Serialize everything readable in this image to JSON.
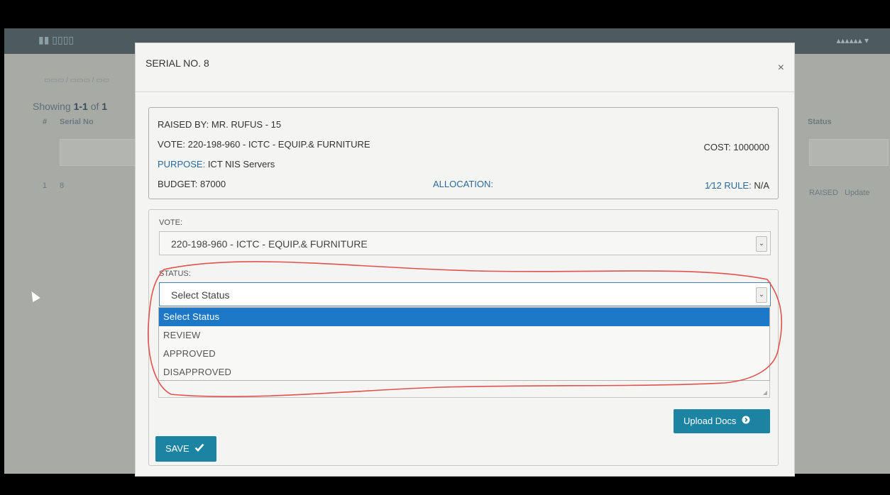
{
  "background": {
    "showing_prefix": "Showing",
    "showing_range": "1-1",
    "showing_of": "of",
    "showing_total": "1",
    "col_index": "#",
    "col_serial": "Serial No",
    "col_status": "Status",
    "row_index": "1",
    "row_serial": "8",
    "row_status": "RAISED",
    "row_action": "Update"
  },
  "modal": {
    "title": "SERIAL NO. 8",
    "close_symbol": "×",
    "info": {
      "raised_by_label": "RAISED BY:",
      "raised_by_value": "MR. RUFUS - 15",
      "vote_label": "VOTE:",
      "vote_value": "220-198-960 - ICTC - EQUIP.& FURNITURE",
      "cost_label": "COST:",
      "cost_value": "1000000",
      "purpose_label": "PURPOSE:",
      "purpose_value": "ICT NIS Servers",
      "budget_label": "BUDGET:",
      "budget_value": "87000",
      "allocation_label": "ALLOCATION:",
      "allocation_value": "",
      "rule_label": "1⁄12 RULE:",
      "rule_value": "N/A"
    },
    "form": {
      "vote_label": "VOTE:",
      "vote_selected": "220-198-960 - ICTC - EQUIP.& FURNITURE",
      "status_label": "STATUS:",
      "status_selected": "Select Status",
      "status_options": [
        "Select Status",
        "REVIEW",
        "APPROVED",
        "DISAPPROVED"
      ]
    },
    "upload_button": "Upload Docs",
    "save_button": "SAVE"
  },
  "colors": {
    "primary_button": "#1c83a3",
    "option_highlight": "#1e78c8",
    "annotation_stroke": "#e0524f",
    "label_blue": "#2b6a99"
  },
  "icons": {
    "close": "close-icon",
    "dropdown": "chevron-down-icon",
    "upload": "circle-arrow-icon",
    "save": "checkmark-icon"
  }
}
